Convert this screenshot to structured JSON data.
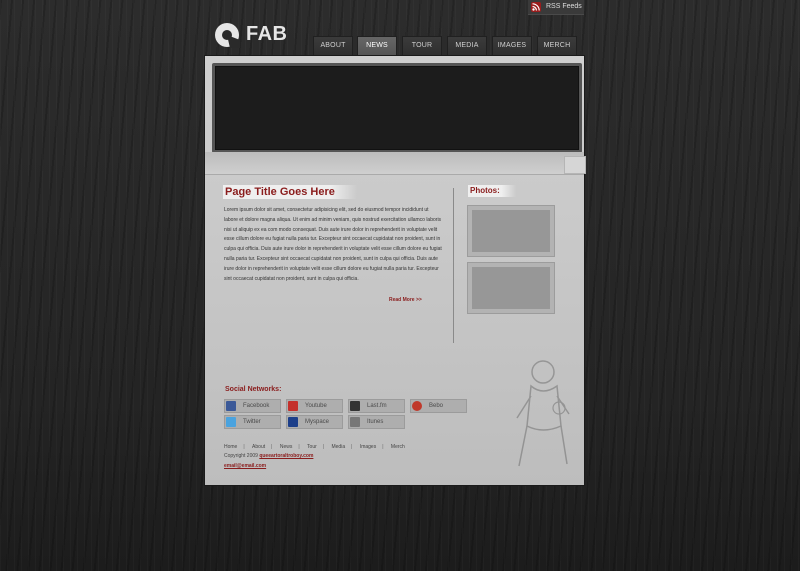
{
  "header": {
    "rss_label": "RSS Feeds",
    "logo_text": "FAB"
  },
  "nav": {
    "items": [
      {
        "label": "ABOUT"
      },
      {
        "label": "NEWS"
      },
      {
        "label": "TOUR"
      },
      {
        "label": "MEDIA"
      },
      {
        "label": "IMAGES"
      },
      {
        "label": "MERCH"
      }
    ],
    "active": "NEWS"
  },
  "content": {
    "page_title": "Page Title Goes Here",
    "body": "Lorem ipsum dolor sit amet, consectetur adipisicing elit, sed do eiusmod tempor incididunt ut labore et dolore magna aliqua. Ut enim ad minim veniam, quis nostrud exercitation ullamco laboris nisi ut aliquip ex ea com modo consequat. Duis aute irure dolor in reprehenderit in voluptate velit esse cillum dolore eu fugiat nulla paria tur. Excepteur sint occaecat cupidatat non proident, sunt in culpa qui officia. Duis aute irure dolor in reprehenderit in voluptate velit esse cillum dolore eu fugiat nulla paria tur. Excepteur sint occaecat cupidatat non proident, sunt in culpa qui officia. Duis aute irure dolor in reprehenderit in voluptate velit esse cillum dolore eu fugiat nulla paria tur. Excepteur sint occaecat cupidatat non proident, sunt in culpa qui officia.",
    "read_more": "Read More >>"
  },
  "sidebar": {
    "photos_title": "Photos:"
  },
  "social": {
    "title": "Social Networks:",
    "items": [
      {
        "label": "Facebook",
        "icon": "facebook-icon",
        "color": "#3b5998"
      },
      {
        "label": "Youtube",
        "icon": "youtube-icon",
        "color": "#c4302b"
      },
      {
        "label": "Last.fm",
        "icon": "lastfm-icon",
        "color": "#333333"
      },
      {
        "label": "Bebo",
        "icon": "bebo-icon",
        "color": "#c0392b"
      },
      {
        "label": "Twitter",
        "icon": "twitter-icon",
        "color": "#4aa3df"
      },
      {
        "label": "Myspace",
        "icon": "myspace-icon",
        "color": "#1d3f8a"
      },
      {
        "label": "Itunes",
        "icon": "itunes-icon",
        "color": "#777777"
      }
    ]
  },
  "footer": {
    "links": [
      {
        "label": "Home"
      },
      {
        "label": "About"
      },
      {
        "label": "News"
      },
      {
        "label": "Tour"
      },
      {
        "label": "Media"
      },
      {
        "label": "Images"
      },
      {
        "label": "Merch"
      }
    ],
    "separator": "|",
    "copyright_prefix": "Copyright 2009",
    "copyright_link": "queeartoraltroboy.com",
    "email": "email@email.com"
  },
  "colors": {
    "accent": "#8a1c1c",
    "page_bg": "#c9c9c9",
    "site_bg": "#2a2a2a"
  }
}
